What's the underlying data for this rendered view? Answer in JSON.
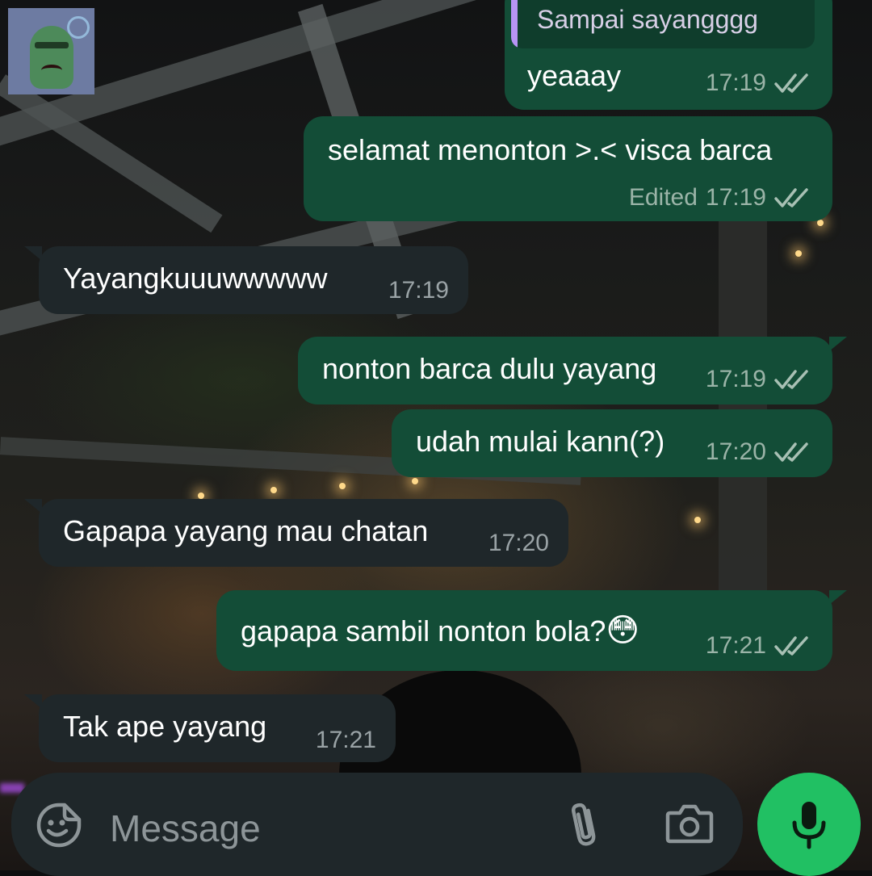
{
  "chat": {
    "quoted_preview": "Sampai sayangggg",
    "messages": [
      {
        "direction": "outgoing",
        "text": "yeaaay",
        "time": "17:19",
        "edited": "",
        "status": "read"
      },
      {
        "direction": "outgoing",
        "text": "selamat menonton >.< visca barca",
        "time": "17:19",
        "edited": "Edited",
        "status": "read"
      },
      {
        "direction": "incoming",
        "text": "Yayangkuuuwwwww",
        "time": "17:19"
      },
      {
        "direction": "outgoing",
        "text": "nonton barca dulu yayang",
        "time": "17:19",
        "status": "read"
      },
      {
        "direction": "outgoing",
        "text": "udah mulai kann(?)",
        "time": "17:20",
        "status": "read"
      },
      {
        "direction": "incoming",
        "text": "Gapapa yayang mau chatan",
        "time": "17:20"
      },
      {
        "direction": "outgoing",
        "text": "gapapa sambil nonton bola?",
        "emoji": "😳",
        "time": "17:21",
        "status": "read"
      },
      {
        "direction": "incoming",
        "text": "Tak ape yayang",
        "time": "17:21"
      }
    ]
  },
  "composer": {
    "placeholder": "Message",
    "icons": {
      "emoji": "sticker-smile-icon",
      "attach": "paperclip-icon",
      "camera": "camera-icon",
      "mic": "microphone-icon"
    }
  },
  "colors": {
    "outgoing_bubble": "#134d37",
    "incoming_bubble": "#1f272a",
    "read_ticks": "#a8c0b4",
    "mic_button": "#21c063",
    "quote_bar": "#b794f4"
  }
}
